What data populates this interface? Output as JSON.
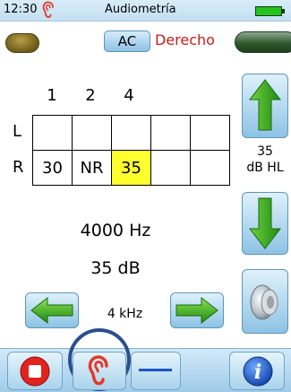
{
  "status_bar": {
    "time": "12:30",
    "title": "Audiometría",
    "battery_color": "#24c31d"
  },
  "top": {
    "mode_button": "AC",
    "side": "Derecho",
    "side_color": "#cc1a1a"
  },
  "grid": {
    "columns": [
      "1",
      "2",
      "4",
      "",
      ""
    ],
    "rows": [
      {
        "label": "L",
        "cells": [
          "",
          "",
          "",
          "",
          ""
        ]
      },
      {
        "label": "R",
        "cells": [
          "30",
          "NR",
          "35",
          "",
          ""
        ]
      }
    ],
    "selected_cell_color": "#ffff2e"
  },
  "readout": {
    "frequency": "4000 Hz",
    "level": "35 dB"
  },
  "level_panel": {
    "value": "35",
    "unit": "dB HL"
  },
  "frequency_nav": {
    "label": "4 kHz"
  },
  "icons": {
    "status_ear": "ear-icon",
    "level_up": "arrow-up-icon",
    "level_down": "arrow-down-icon",
    "freq_prev": "arrow-left-icon",
    "freq_next": "arrow-right-icon",
    "tone": "speaker-icon",
    "stop": "stop-icon",
    "ear_select": "ear-icon",
    "minus": "minus-icon",
    "info": "info-icon"
  }
}
